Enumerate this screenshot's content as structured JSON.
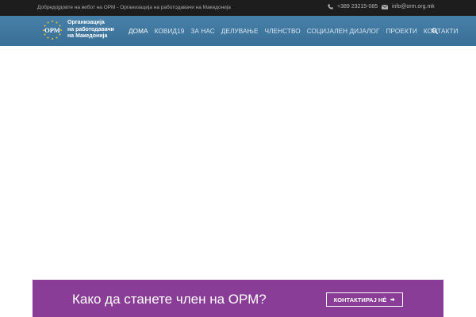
{
  "topbar": {
    "welcome": "Добредојдовте на вебот на ОРМ - Организација на работодавачи на Македонија",
    "phone": "+389 23215-085",
    "email": "info@orm.org.mk",
    "phone_icon": "phone-icon",
    "email_icon": "envelope-icon"
  },
  "logo": {
    "mark": "ОРМ",
    "line1": "Организација",
    "line2": "на работодавачи",
    "line3": "на Македонија"
  },
  "nav": {
    "items": [
      {
        "label": "ДОМА"
      },
      {
        "label": "КОВИД19"
      },
      {
        "label": "ЗА НАС"
      },
      {
        "label": "ДЕЛУВАЊЕ"
      },
      {
        "label": "ЧЛЕНСТВО"
      },
      {
        "label": "СОЦИЈАЛЕН ДИЈАЛОГ"
      },
      {
        "label": "ПРОЕКТИ"
      },
      {
        "label": "КОНТАКТИ"
      }
    ],
    "search_icon": "search-icon"
  },
  "cta": {
    "text": "Како да станете член на ОРМ?",
    "button_label": "КОНТАКТИРАЈ НÈ",
    "button_icon": "arrow-right-icon"
  },
  "colors": {
    "topbar": "#1d1d1d",
    "navbar": "#3f77a0",
    "cta": "#8a3d96",
    "logo_stars": "#f0c419"
  }
}
